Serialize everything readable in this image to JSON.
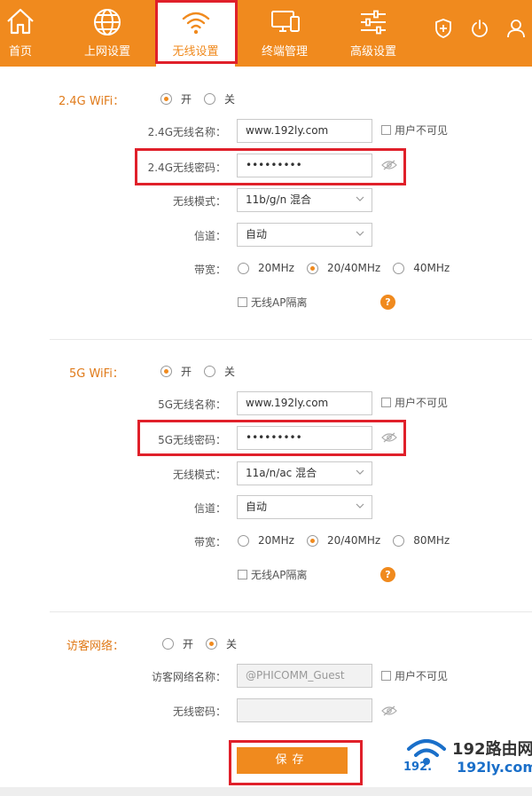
{
  "nav": {
    "items": [
      {
        "label": "首页",
        "icon": "home-icon"
      },
      {
        "label": "上网设置",
        "icon": "globe-icon"
      },
      {
        "label": "无线设置",
        "icon": "wifi-icon",
        "active": true
      },
      {
        "label": "终端管理",
        "icon": "devices-icon"
      },
      {
        "label": "高级设置",
        "icon": "sliders-icon"
      }
    ],
    "right_icons": [
      "shield-plus-icon",
      "power-icon",
      "user-icon"
    ]
  },
  "wifi24": {
    "title": "2.4G WiFi：",
    "on_label": "开",
    "off_label": "关",
    "enabled": true,
    "ssid_label": "2.4G无线名称：",
    "ssid_value": "www.192ly.com",
    "hidden_label": "用户不可见",
    "password_label": "2.4G无线密码：",
    "password_value": "•••••••••",
    "mode_label": "无线模式：",
    "mode_value": "11b/g/n 混合",
    "channel_label": "信道：",
    "channel_value": "自动",
    "bandwidth_label": "带宽：",
    "bandwidth_options": [
      "20MHz",
      "20/40MHz",
      "40MHz"
    ],
    "bandwidth_selected": "20/40MHz",
    "ap_isolation_label": "无线AP隔离",
    "help": "?"
  },
  "wifi5": {
    "title": "5G WiFi：",
    "on_label": "开",
    "off_label": "关",
    "enabled": true,
    "ssid_label": "5G无线名称：",
    "ssid_value": "www.192ly.com",
    "hidden_label": "用户不可见",
    "password_label": "5G无线密码：",
    "password_value": "•••••••••",
    "mode_label": "无线模式：",
    "mode_value": "11a/n/ac 混合",
    "channel_label": "信道：",
    "channel_value": "自动",
    "bandwidth_label": "带宽：",
    "bandwidth_options": [
      "20MHz",
      "20/40MHz",
      "80MHz"
    ],
    "bandwidth_selected": "20/40MHz",
    "ap_isolation_label": "无线AP隔离",
    "help": "?"
  },
  "guest": {
    "title": "访客网络：",
    "on_label": "开",
    "off_label": "关",
    "enabled": false,
    "ssid_label": "访客网络名称：",
    "ssid_value": "@PHICOMM_Guest",
    "hidden_label": "用户不可见",
    "password_label": "无线密码：",
    "password_value": ""
  },
  "save_label": "保存",
  "watermark": {
    "brand": "192路由网",
    "ip": "192.",
    "domain": "192ly.com"
  },
  "colors": {
    "accent": "#f08a1e",
    "highlight": "#e0202a"
  }
}
